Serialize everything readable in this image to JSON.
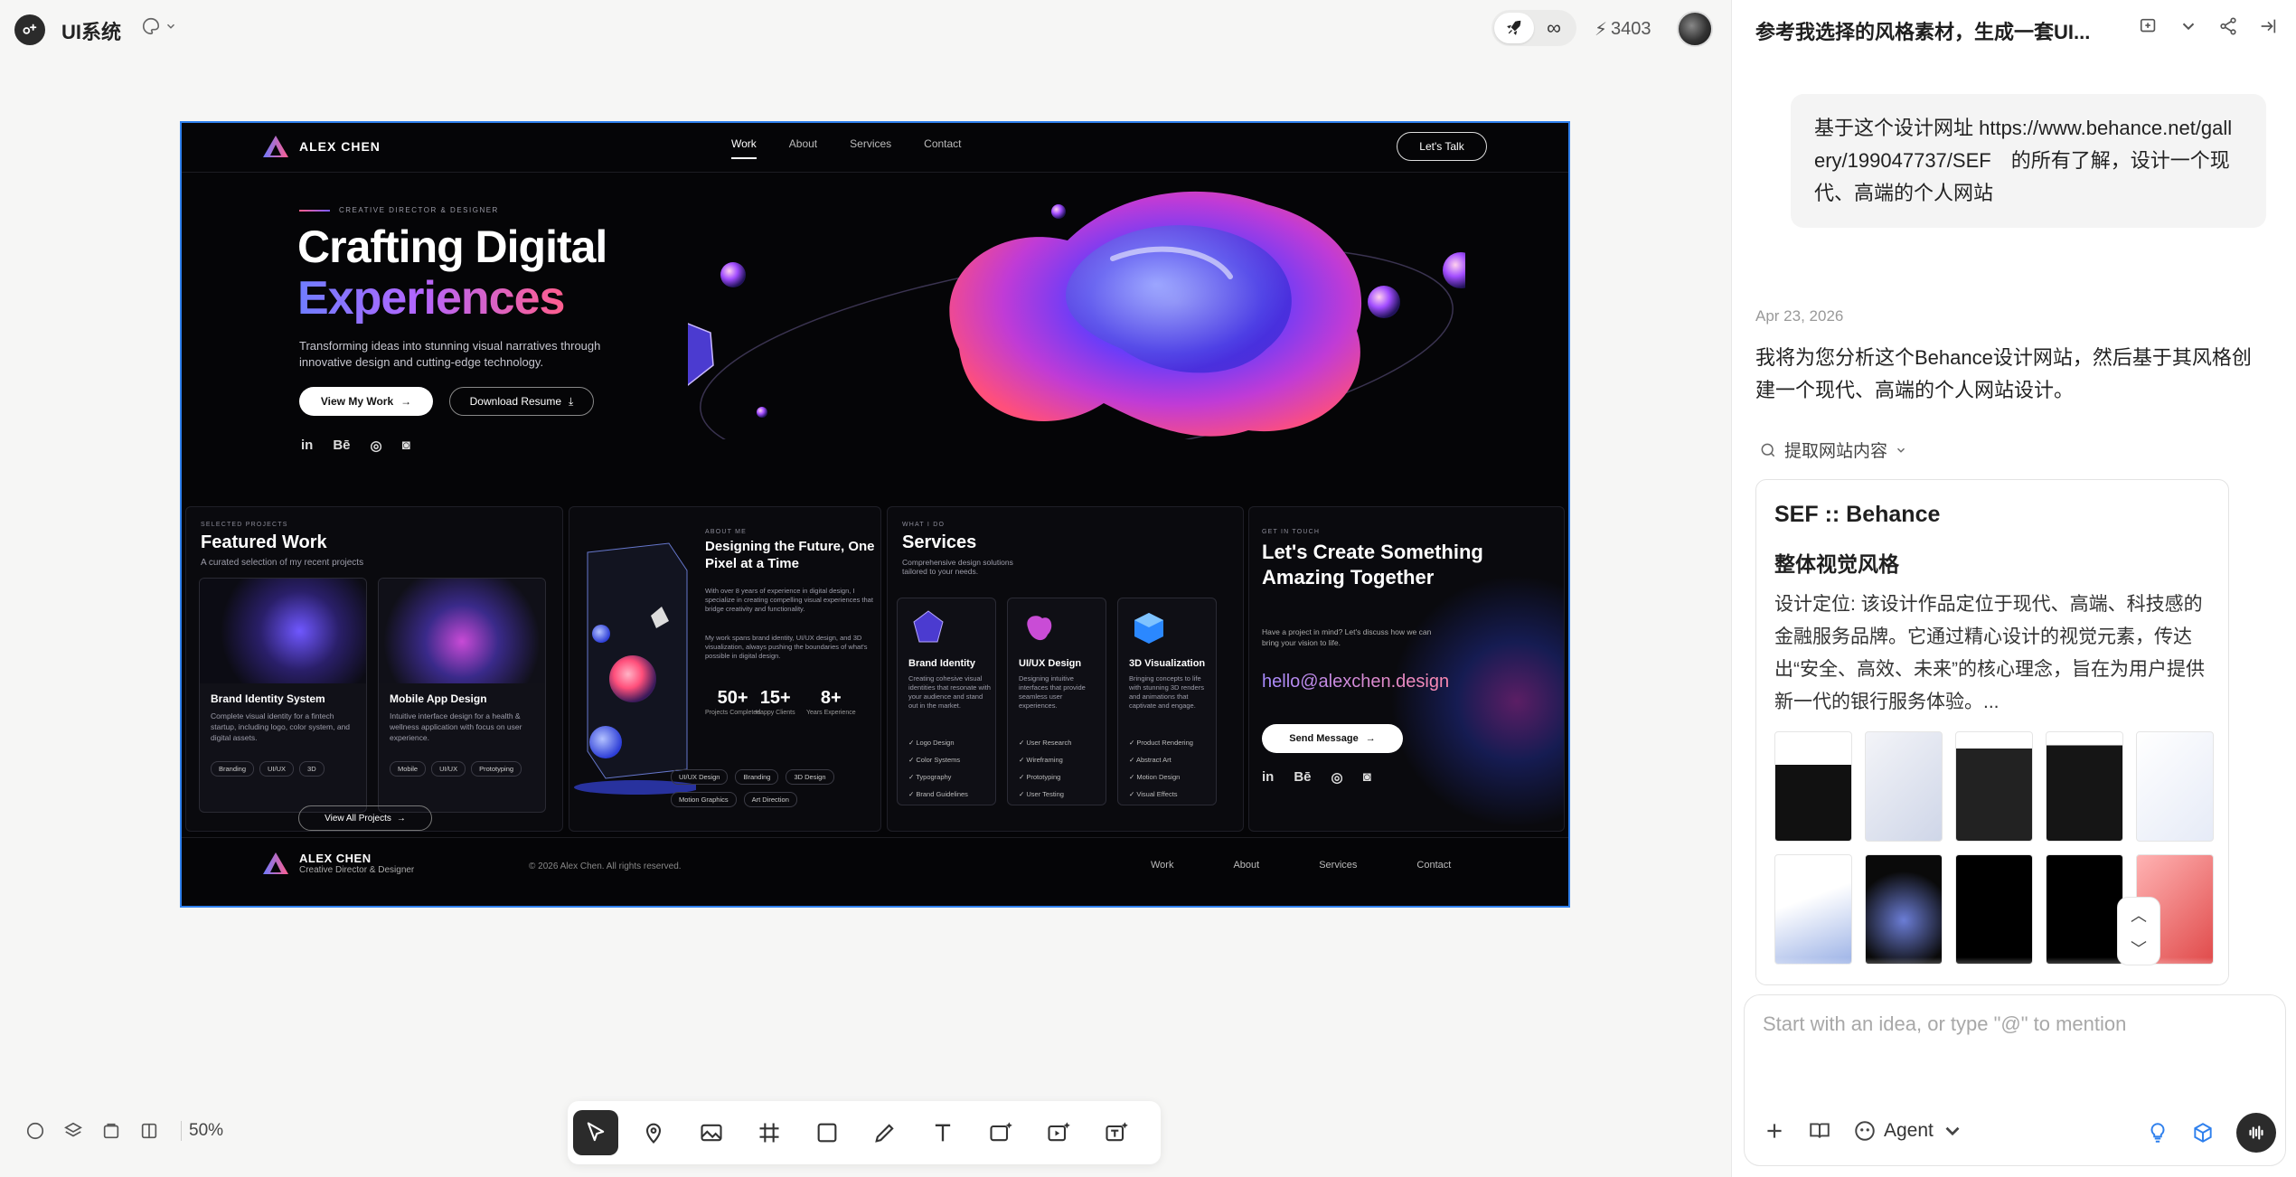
{
  "app": {
    "project_name": "UI系统",
    "credits": "3403",
    "infinity_label": "∞",
    "zoom": "50%"
  },
  "site": {
    "brand": "ALEX CHEN",
    "nav": [
      "Work",
      "About",
      "Services",
      "Contact"
    ],
    "cta": "Let's Talk",
    "eyebrow": "CREATIVE DIRECTOR & DESIGNER",
    "headline_1": "Crafting Digital",
    "headline_2": "Experiences",
    "subtitle": "Transforming ideas into stunning visual narratives through innovative design and cutting-edge technology.",
    "btn_primary": "View My Work",
    "btn_secondary": "Download Resume",
    "social": [
      "in",
      "Bē",
      "◎",
      "◙"
    ],
    "featured": {
      "eyebrow": "SELECTED PROJECTS",
      "title": "Featured Work",
      "subtitle": "A curated selection of my recent projects",
      "projects": [
        {
          "title": "Brand Identity System",
          "desc": "Complete visual identity for a fintech startup, including logo, color system, and digital assets.",
          "tags": [
            "Branding",
            "UI/UX",
            "3D"
          ]
        },
        {
          "title": "Mobile App Design",
          "desc": "Intuitive interface design for a health & wellness application with focus on user experience.",
          "tags": [
            "Mobile",
            "UI/UX",
            "Prototyping"
          ]
        }
      ],
      "view_all": "View All Projects"
    },
    "about": {
      "eyebrow": "ABOUT ME",
      "title": "Designing the Future, One Pixel at a Time",
      "p1": "With over 8 years of experience in digital design, I specialize in creating compelling visual experiences that bridge creativity and functionality.",
      "p2": "My work spans brand identity, UI/UX design, and 3D visualization, always pushing the boundaries of what's possible in digital design.",
      "stats": [
        {
          "value": "50+",
          "label": "Projects Completed"
        },
        {
          "value": "15+",
          "label": "Happy Clients"
        },
        {
          "value": "8+",
          "label": "Years Experience"
        }
      ],
      "tags": [
        "UI/UX Design",
        "Branding",
        "3D Design",
        "Motion Graphics",
        "Art Direction"
      ]
    },
    "services": {
      "eyebrow": "WHAT I DO",
      "title": "Services",
      "subtitle": "Comprehensive design solutions tailored to your needs.",
      "items": [
        {
          "name": "Brand Identity",
          "desc": "Creating cohesive visual identities that resonate with your audience and stand out in the market.",
          "list": [
            "Logo Design",
            "Color Systems",
            "Typography",
            "Brand Guidelines"
          ]
        },
        {
          "name": "UI/UX Design",
          "desc": "Designing intuitive interfaces that provide seamless user experiences.",
          "list": [
            "User Research",
            "Wireframing",
            "Prototyping",
            "User Testing"
          ]
        },
        {
          "name": "3D Visualization",
          "desc": "Bringing concepts to life with stunning 3D renders and animations that captivate and engage.",
          "list": [
            "Product Rendering",
            "Abstract Art",
            "Motion Design",
            "Visual Effects"
          ]
        }
      ]
    },
    "contact": {
      "eyebrow": "GET IN TOUCH",
      "title": "Let's Create Something Amazing Together",
      "subtitle": "Have a project in mind? Let's discuss how we can bring your vision to life.",
      "email": "hello@alexchen.design",
      "button": "Send Message"
    },
    "footer": {
      "brand": "ALEX CHEN",
      "role": "Creative Director & Designer",
      "copyright": "© 2026 Alex Chen. All rights reserved.",
      "links": [
        "Work",
        "About",
        "Services",
        "Contact"
      ]
    }
  },
  "panel": {
    "title": "参考我选择的风格素材，生成一套UI...",
    "user_message": "基于这个设计网址 https://www.behance.net/gallery/199047737/SEF　的所有了解，设计一个现代、高端的个人网站",
    "date": "Apr 23, 2026",
    "assistant_message": "我将为您分析这个Behance设计网站，然后基于其风格创建一个现代、高端的个人网站设计。",
    "tool_call": "提取网站内容",
    "result": {
      "title": "SEF :: Behance",
      "heading": "整体视觉风格",
      "body": "设计定位: 该设计作品定位于现代、高端、科技感的金融服务品牌。它通过精心设计的视觉元素，传达出“安全、高效、未来”的核心理念，旨在为用户提供新一代的银行服务体验。..."
    },
    "composer_placeholder": "Start with an idea, or type \"@\" to mention",
    "agent_label": "Agent"
  }
}
